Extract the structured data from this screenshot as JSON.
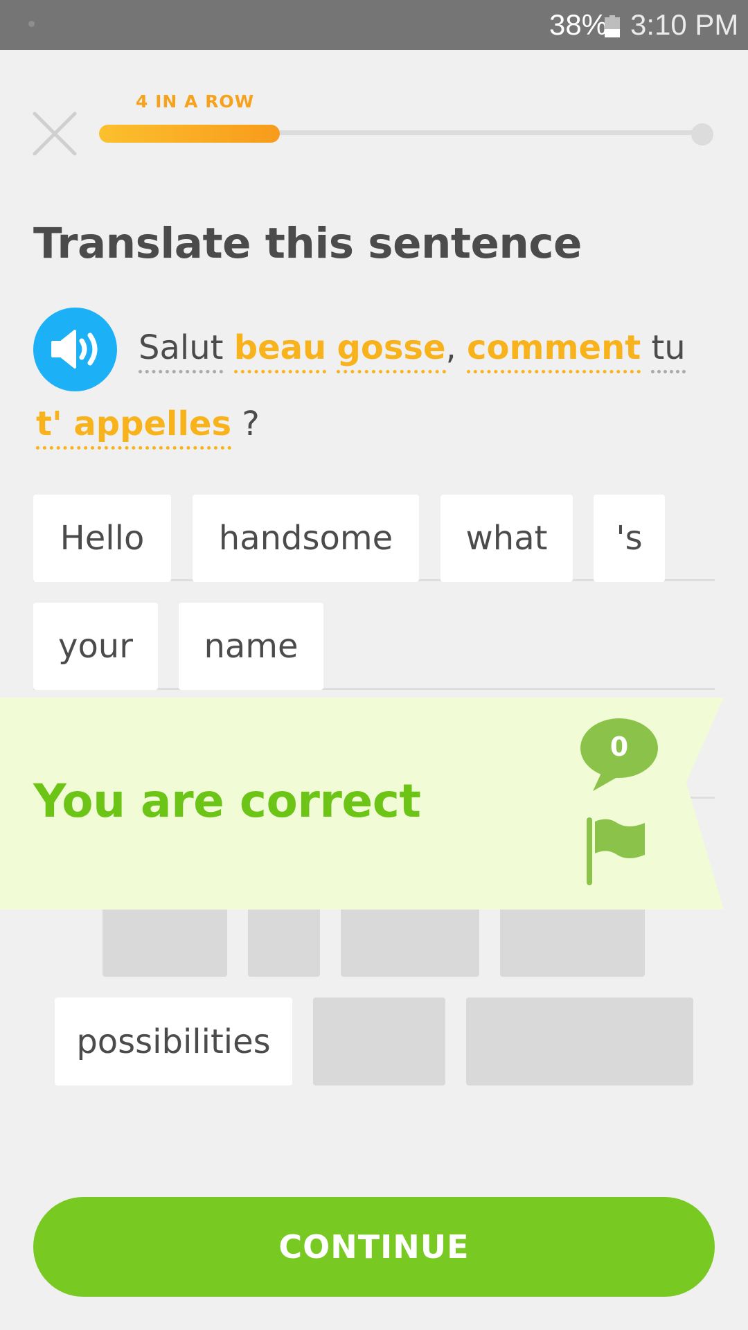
{
  "status_bar": {
    "battery": "38%",
    "time": "3:10 PM"
  },
  "header": {
    "streak": "4 IN A ROW",
    "progress": 0.3
  },
  "title": "Translate this sentence",
  "sentence": {
    "words": [
      "Salut",
      "beau",
      "gosse",
      ",",
      "comment",
      "tu",
      "t'",
      "appelles",
      "?"
    ]
  },
  "answer": {
    "chips": [
      "Hello",
      "handsome",
      "what",
      "'s",
      "your",
      "name"
    ]
  },
  "word_bank": {
    "visible": [
      "possibilities"
    ]
  },
  "feedback": {
    "message": "You are correct",
    "discussion_count": "0"
  },
  "footer": {
    "continue_label": "CONTINUE"
  },
  "colors": {
    "accent_blue": "#1cb0f6",
    "correct_green": "#78c922",
    "highlight_orange": "#f8b31c"
  }
}
